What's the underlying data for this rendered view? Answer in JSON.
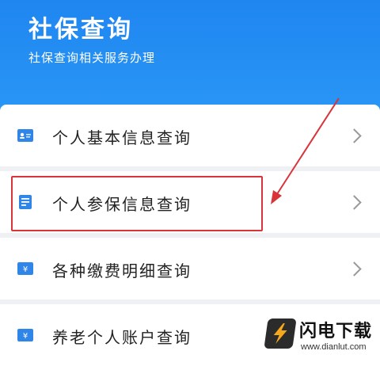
{
  "header": {
    "title": "社保查询",
    "subtitle": "社保查询相关服务办理"
  },
  "items": [
    {
      "label": "个人基本信息查询",
      "icon": "id-card-icon"
    },
    {
      "label": "个人参保信息查询",
      "icon": "document-icon"
    },
    {
      "label": "各种缴费明细查询",
      "icon": "payment-icon"
    },
    {
      "label": "养老个人账户查询",
      "icon": "account-icon"
    }
  ],
  "annotation": {
    "highlight_color": "#d8343a",
    "arrow_color": "#d8343a"
  },
  "watermark": {
    "title": "闪电下载",
    "url": "www.dianlut.com"
  },
  "colors": {
    "header_blue": "#2a97f6",
    "icon_blue": "#2f86e8"
  }
}
